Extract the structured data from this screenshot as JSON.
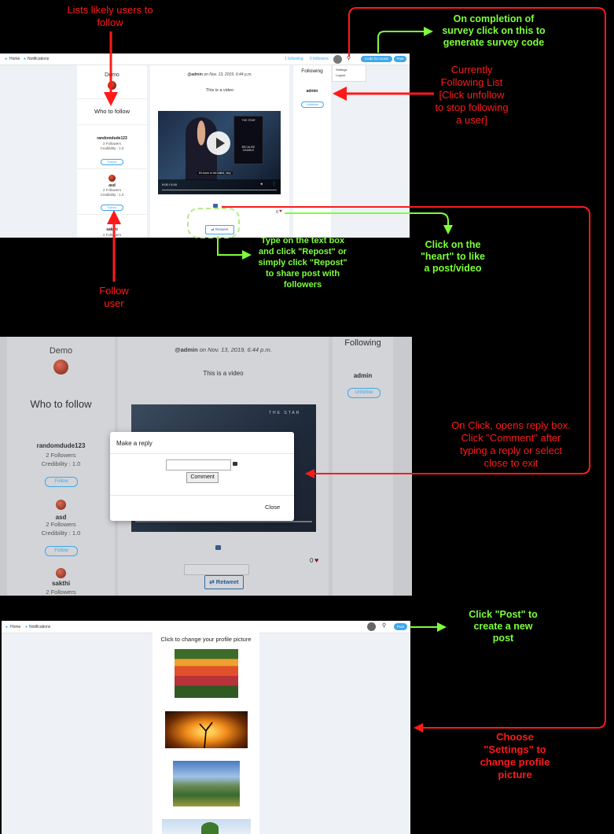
{
  "annotations": {
    "lists_users": "Lists likely users to\nfollow",
    "survey": "On completion of\nsurvey click on this to\ngenerate survey code",
    "following_list": "Currently\nFollowing List\n[Click unfollow\nto stop following\na user]",
    "repost": "Type on the text box\nand click \"Repost\" or\nsimply click \"Repost\"\nto share post with\nfollowers",
    "heart": "Click on the\n\"heart\" to like\na post/video",
    "follow_user": "Follow\nuser",
    "reply": "On Click, opens reply box.\nClick \"Comment\" after\ntyping a reply or select\nclose to exit",
    "post": "Click \"Post\" to\ncreate a new\npost",
    "settings": "Choose\n\"Settings\" to\nchange profile\npicture"
  },
  "nav": {
    "home": "Home",
    "notifications": "Notifications",
    "following": "1 following",
    "followers": "0 followers",
    "code_btn": "Code for music",
    "post_btn": "Post",
    "menu_settings": "Settings",
    "menu_logout": "Logout"
  },
  "profile": {
    "name": "Demo",
    "who_to_follow": "Who to follow"
  },
  "users": [
    {
      "name": "randomdude123",
      "followers": "2 Followers",
      "credibility": "Credibility : 1.0",
      "btn": "Follow"
    },
    {
      "name": "asd",
      "followers": "2 Followers",
      "credibility": "Credibility : 1.0",
      "btn": "Follow"
    },
    {
      "name": "sakthi",
      "followers": "2 Followers",
      "credibility": "",
      "btn": ""
    }
  ],
  "post": {
    "author": "@admin",
    "meta": " on Nov. 13, 2019, 6:44 p.m.",
    "text": "This is a video",
    "video_time": "0:00 / 0:16",
    "caption": "It's been in the ballot, very",
    "book_title": "THE STAR",
    "book_sub": "BECAUSE\nGAMBLE",
    "likes": "0",
    "repost": "Retweet"
  },
  "following_col": {
    "title": "Following",
    "user": "admin",
    "btn": "Unfollow"
  },
  "modal": {
    "title": "Make a reply",
    "comment": "Comment",
    "close": "Close"
  },
  "settings_page": {
    "title": "Click to change your profile picture"
  },
  "colors": {
    "accent": "#3fa7ea",
    "red": "#ff1a1a",
    "green": "#7dff3a"
  }
}
